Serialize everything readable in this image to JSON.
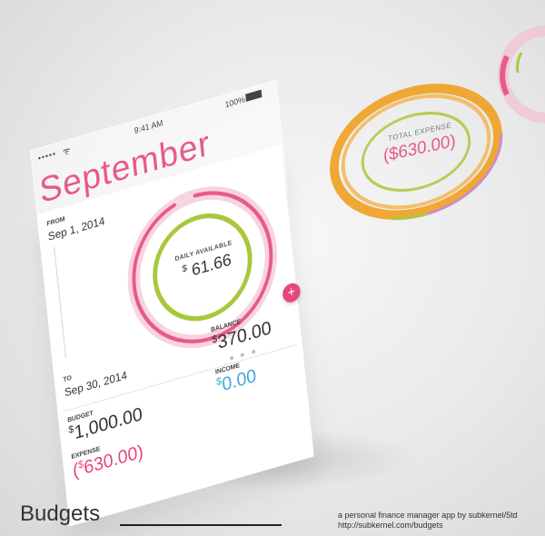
{
  "status_bar": {
    "signal": "•••••",
    "wifi_icon": "ᯤ",
    "time": "9:41 AM",
    "battery": "100%"
  },
  "period": {
    "month": "September",
    "from_label": "FROM",
    "from_date": "Sep 1, 2014",
    "to_label": "TO",
    "to_date": "Sep 30, 2014"
  },
  "gauge": {
    "label": "DAILY AVAILABLE",
    "currency": "$",
    "amount": "61.66",
    "outer_progress": 0.95,
    "inner_progress": 1.0,
    "colors": {
      "outer": "#e85a88",
      "inner": "#a8c83c"
    }
  },
  "add_button": {
    "icon": "+",
    "color": "#e8457c"
  },
  "page_indicator": {
    "count": 3
  },
  "summary": {
    "balance_label": "BALANCE",
    "balance_currency": "$",
    "balance_amount": "370.00",
    "budget_label": "BUDGET",
    "budget_currency": "$",
    "budget_amount": "1,000.00",
    "income_label": "INCOME",
    "income_currency": "$",
    "income_amount": "0.00",
    "expense_label": "EXPENSE",
    "expense_prefix": "(",
    "expense_currency": "$",
    "expense_amount": "630.00)"
  },
  "floating_ring": {
    "label": "TOTAL EXPENSE",
    "value": "($630.00)",
    "colors": {
      "orange": "#f0a020",
      "green": "#a8c83c",
      "purple": "#c58ad9",
      "pink": "#e85a88"
    }
  },
  "footer": {
    "brand": "Budgets",
    "tagline": "a personal finance manager app by subkernel/5td",
    "url": "http://subkernel.com/budgets"
  }
}
